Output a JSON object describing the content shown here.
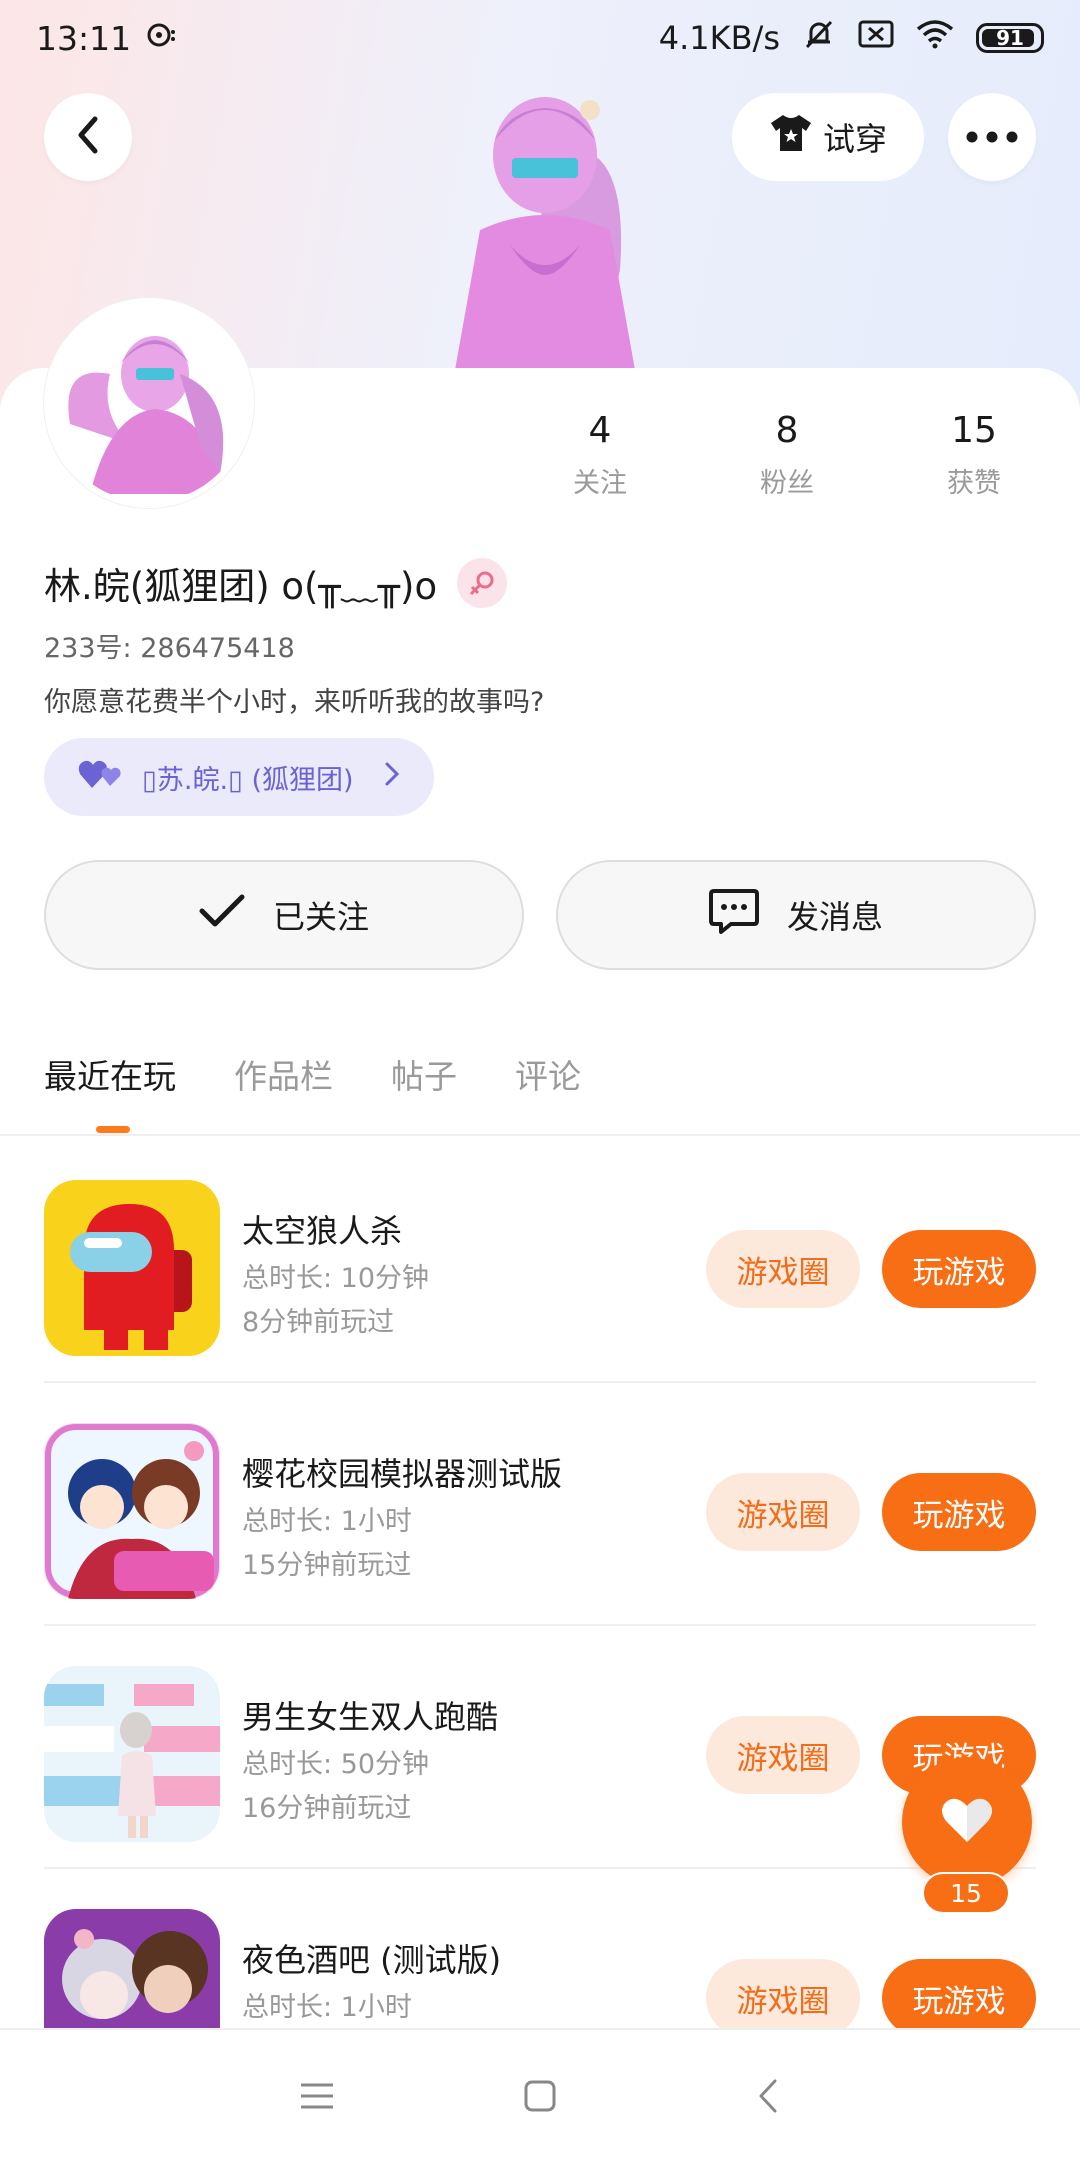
{
  "status_bar": {
    "time": "13:11",
    "speed": "4.1KB/s",
    "battery": "91"
  },
  "header": {
    "try_on_label": "试穿"
  },
  "profile": {
    "stats": [
      {
        "value": "4",
        "label": "关注"
      },
      {
        "value": "8",
        "label": "粉丝"
      },
      {
        "value": "15",
        "label": "获赞"
      }
    ],
    "name": "林.皖(狐狸团) o(╥﹏╥)o",
    "uid": "233号: 286475418",
    "bio": "你愿意花费半个小时，来听听我的故事吗?",
    "group_tag": "▯苏.皖.▯ (狐狸团)"
  },
  "actions": {
    "follow_label": "已关注",
    "message_label": "发消息"
  },
  "tabs": [
    {
      "label": "最近在玩",
      "active": true
    },
    {
      "label": "作品栏",
      "active": false
    },
    {
      "label": "帖子",
      "active": false
    },
    {
      "label": "评论",
      "active": false
    }
  ],
  "games": [
    {
      "name": "太空狼人杀",
      "duration": "总时长: 10分钟",
      "last_played": "8分钟前玩过",
      "circle_label": "游戏圈",
      "play_label": "玩游戏"
    },
    {
      "name": "樱花校园模拟器测试版",
      "duration": "总时长: 1小时",
      "last_played": "15分钟前玩过",
      "circle_label": "游戏圈",
      "play_label": "玩游戏"
    },
    {
      "name": "男生女生双人跑酷",
      "duration": "总时长: 50分钟",
      "last_played": "16分钟前玩过",
      "circle_label": "游戏圈",
      "play_label": "玩游戏"
    },
    {
      "name": "夜色酒吧 (测试版)",
      "duration": "总时长: 1小时",
      "last_played": "",
      "circle_label": "游戏圈",
      "play_label": "玩游戏"
    }
  ],
  "like": {
    "count": "15"
  },
  "colors": {
    "accent": "#f86e14",
    "accent_light": "#fde9dc",
    "tag_bg": "#ebeafb",
    "tag_text": "#6b63d3"
  },
  "icons": {
    "back": "chevron-left-icon",
    "more": "more-horizontal-icon",
    "try_on": "tshirt-icon",
    "follow": "check-icon",
    "message": "chat-bubble-icon",
    "like": "heart-icon",
    "group": "heart-pair-icon"
  }
}
